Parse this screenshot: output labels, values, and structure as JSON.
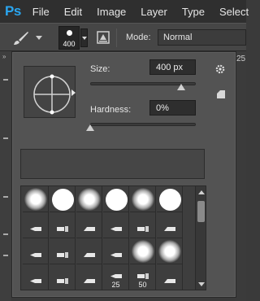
{
  "menubar": {
    "logo": "Ps",
    "items": [
      "File",
      "Edit",
      "Image",
      "Layer",
      "Type",
      "Select"
    ]
  },
  "options_bar": {
    "tool_icon": "brush-tool-icon",
    "brush_size_display": "400",
    "mode_label": "Mode:",
    "mode_value": "Normal"
  },
  "right_strip": {
    "partial_number": "25"
  },
  "brush_picker": {
    "size_label": "Size:",
    "size_value": "400 px",
    "size_fraction": 0.86,
    "hardness_label": "Hardness:",
    "hardness_value": "0%",
    "hardness_fraction": 0.0,
    "gear_icon": "gear-icon",
    "new_preset_icon": "new-preset-icon",
    "presets": [
      {
        "kind": "soft"
      },
      {
        "kind": "hard"
      },
      {
        "kind": "soft"
      },
      {
        "kind": "hard"
      },
      {
        "kind": "soft"
      },
      {
        "kind": "hard"
      },
      {
        "kind": "tip"
      },
      {
        "kind": "tip"
      },
      {
        "kind": "tip"
      },
      {
        "kind": "tip"
      },
      {
        "kind": "tip"
      },
      {
        "kind": "tip"
      },
      {
        "kind": "tip"
      },
      {
        "kind": "tip"
      },
      {
        "kind": "tip"
      },
      {
        "kind": "tip"
      },
      {
        "kind": "soft"
      },
      {
        "kind": "soft"
      },
      {
        "kind": "tip"
      },
      {
        "kind": "tip"
      },
      {
        "kind": "tip"
      },
      {
        "kind": "tip",
        "label": "25"
      },
      {
        "kind": "tip",
        "label": "50"
      },
      {
        "kind": "tip"
      }
    ]
  }
}
